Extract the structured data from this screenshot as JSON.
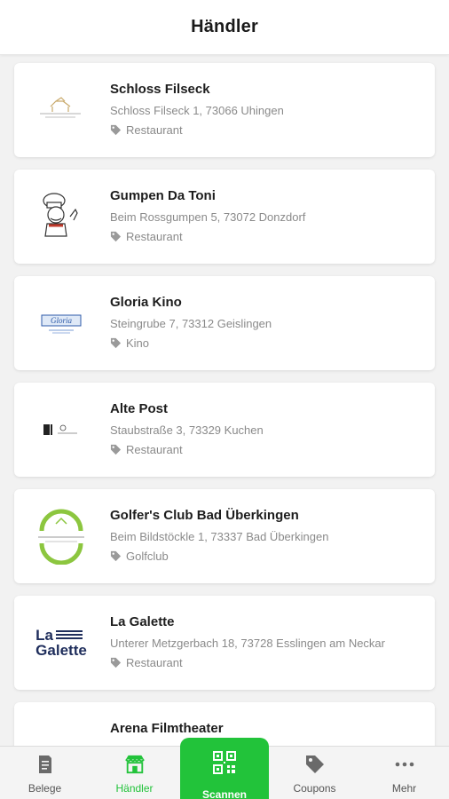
{
  "header": {
    "title": "Händler"
  },
  "merchants": [
    {
      "name": "Schloss Filseck",
      "address": "Schloss Filseck 1, 73066 Uhingen",
      "category": "Restaurant",
      "logo_icon": "schloss-filseck-logo"
    },
    {
      "name": "Gumpen Da Toni",
      "address": "Beim Rossgumpen 5, 73072 Donzdorf",
      "category": "Restaurant",
      "logo_icon": "chef-logo"
    },
    {
      "name": "Gloria Kino",
      "address": "Steingrube 7, 73312 Geislingen",
      "category": "Kino",
      "logo_icon": "gloria-kino-logo"
    },
    {
      "name": "Alte Post",
      "address": "Staubstraße 3, 73329 Kuchen",
      "category": "Restaurant",
      "logo_icon": "alte-post-logo"
    },
    {
      "name": "Golfer's Club Bad Überkingen",
      "address": "Beim Bildstöckle 1, 73337 Bad Überkingen",
      "category": "Golfclub",
      "logo_icon": "golf-restaurant-logo"
    },
    {
      "name": "La Galette",
      "address": "Unterer Metzgerbach 18, 73728 Esslingen am Neckar",
      "category": "Restaurant",
      "logo_icon": "la-galette-logo",
      "logo_text_1": "La",
      "logo_text_2": "Galette"
    },
    {
      "name": "Arena Filmtheater",
      "address": "",
      "category": "",
      "logo_icon": "arena-logo"
    }
  ],
  "tabbar": {
    "items": [
      {
        "label": "Belege",
        "icon": "receipt-icon"
      },
      {
        "label": "Händler",
        "icon": "store-icon"
      },
      {
        "label": "Scannen",
        "icon": "qr-code-icon"
      },
      {
        "label": "Coupons",
        "icon": "tag-icon"
      },
      {
        "label": "Mehr",
        "icon": "more-dots-icon"
      }
    ]
  },
  "colors": {
    "accent": "#22c33a",
    "background": "#f2f2f2",
    "card": "#ffffff",
    "muted_text": "#8a8a8a"
  }
}
